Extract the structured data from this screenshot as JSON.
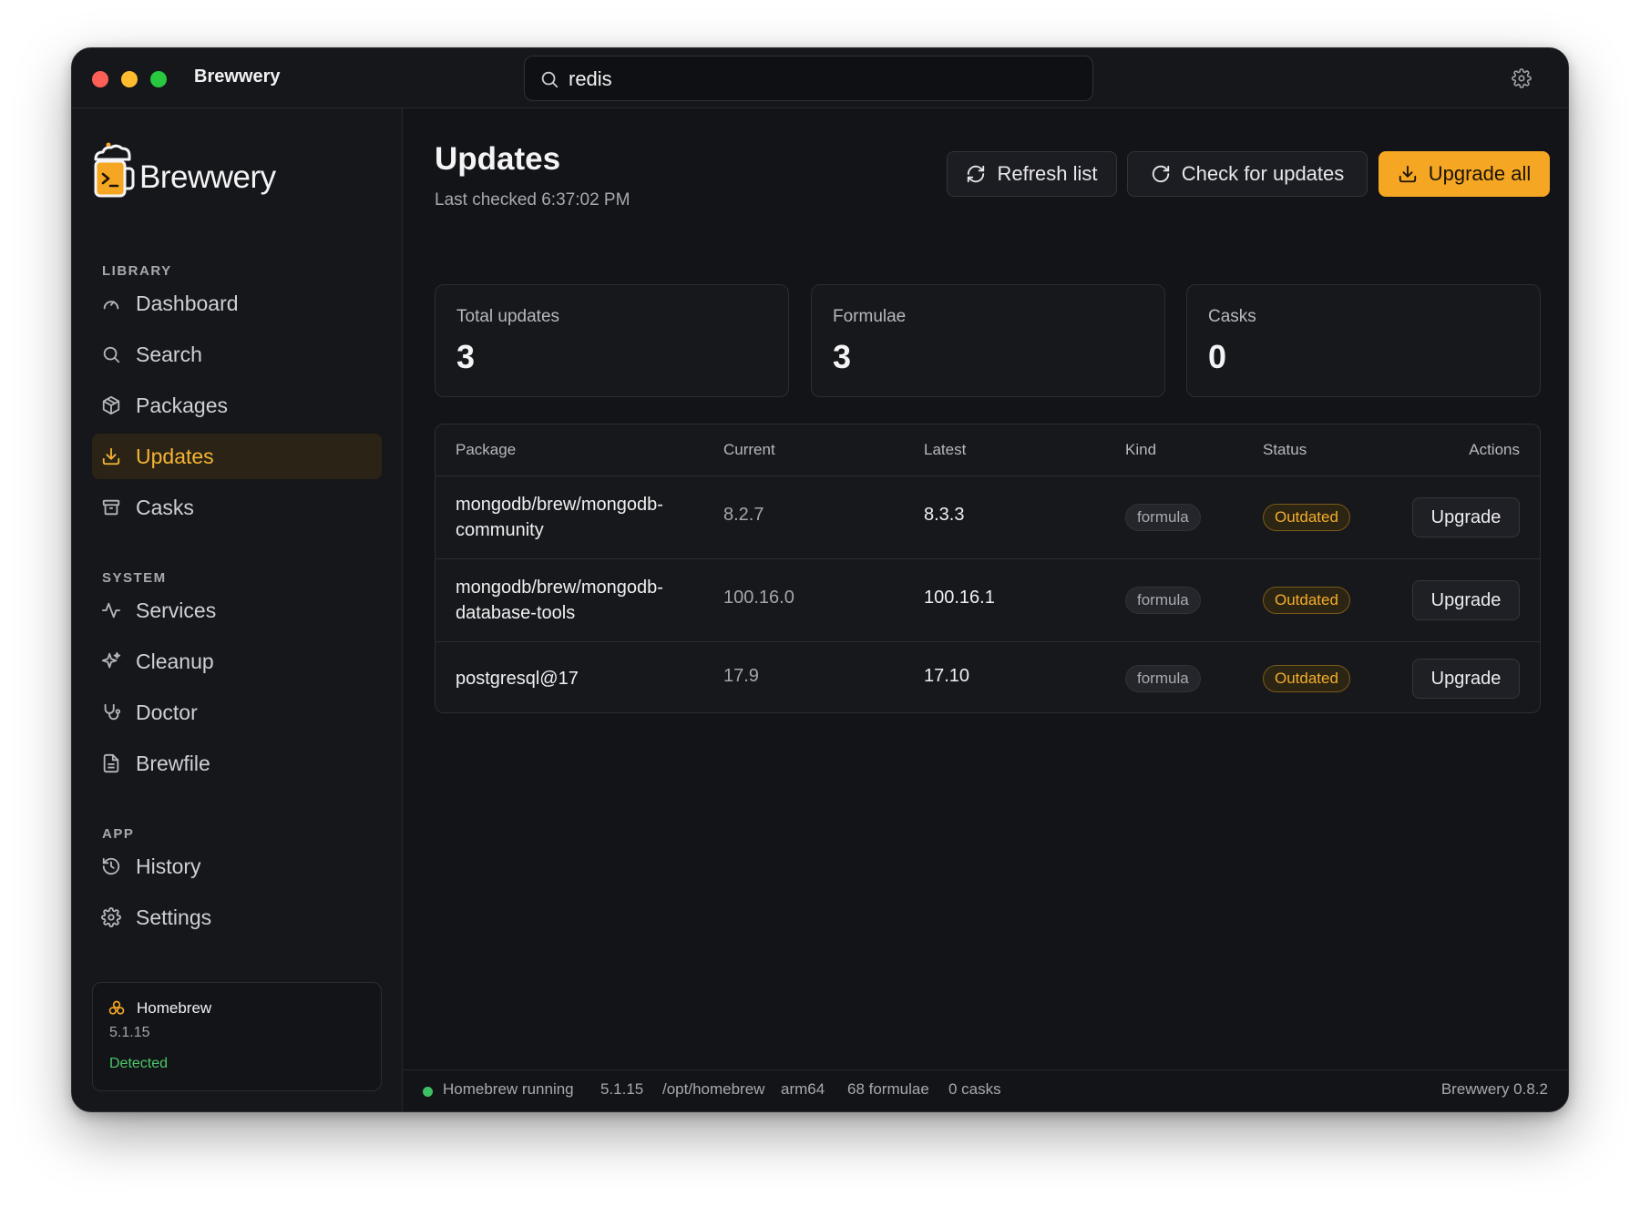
{
  "titlebar": {
    "app_title": "Brewwery",
    "search_value": "redis"
  },
  "sidebar": {
    "logo_text": "Brewwery",
    "sections": {
      "library": "LIBRARY",
      "system": "SYSTEM",
      "app": "APP"
    },
    "items": [
      {
        "label": "Dashboard",
        "icon": "gauge-icon"
      },
      {
        "label": "Search",
        "icon": "search-icon"
      },
      {
        "label": "Packages",
        "icon": "package-icon"
      },
      {
        "label": "Updates",
        "icon": "download-icon",
        "active": true
      },
      {
        "label": "Casks",
        "icon": "archive-icon"
      },
      {
        "label": "Services",
        "icon": "activity-icon"
      },
      {
        "label": "Cleanup",
        "icon": "sparkles-icon"
      },
      {
        "label": "Doctor",
        "icon": "stethoscope-icon"
      },
      {
        "label": "Brewfile",
        "icon": "file-text-icon"
      },
      {
        "label": "History",
        "icon": "history-icon"
      },
      {
        "label": "Settings",
        "icon": "gear-icon"
      }
    ],
    "homebrew_card": {
      "name": "Homebrew",
      "version": "5.1.15",
      "status": "Detected"
    }
  },
  "main": {
    "title": "Updates",
    "last_checked": "Last checked 6:37:02 PM",
    "buttons": {
      "refresh": "Refresh list",
      "check": "Check for updates",
      "upgrade_all": "Upgrade all"
    },
    "stats": [
      {
        "label": "Total updates",
        "value": "3"
      },
      {
        "label": "Formulae",
        "value": "3"
      },
      {
        "label": "Casks",
        "value": "0"
      }
    ],
    "table": {
      "headers": [
        "Package",
        "Current",
        "Latest",
        "Kind",
        "Status",
        "Actions"
      ],
      "rows": [
        {
          "package_line1": "mongodb/brew/mongodb-",
          "package_line2": "community",
          "current": "8.2.7",
          "latest": "8.3.3",
          "kind": "formula",
          "status": "Outdated",
          "action": "Upgrade"
        },
        {
          "package_line1": "mongodb/brew/mongodb-",
          "package_line2": "database-tools",
          "current": "100.16.0",
          "latest": "100.16.1",
          "kind": "formula",
          "status": "Outdated",
          "action": "Upgrade"
        },
        {
          "package_line1": "postgresql@17",
          "package_line2": "",
          "current": "17.9",
          "latest": "17.10",
          "kind": "formula",
          "status": "Outdated",
          "action": "Upgrade"
        }
      ]
    }
  },
  "statusbar": {
    "running": "Homebrew running",
    "version": "5.1.15",
    "path": "/opt/homebrew",
    "arch": "arm64",
    "formulae": "68 formulae",
    "casks": "0 casks",
    "app_version": "Brewwery 0.8.2"
  },
  "colors": {
    "accent": "#f5a623",
    "background": "#131418",
    "success": "#3fbf63"
  }
}
